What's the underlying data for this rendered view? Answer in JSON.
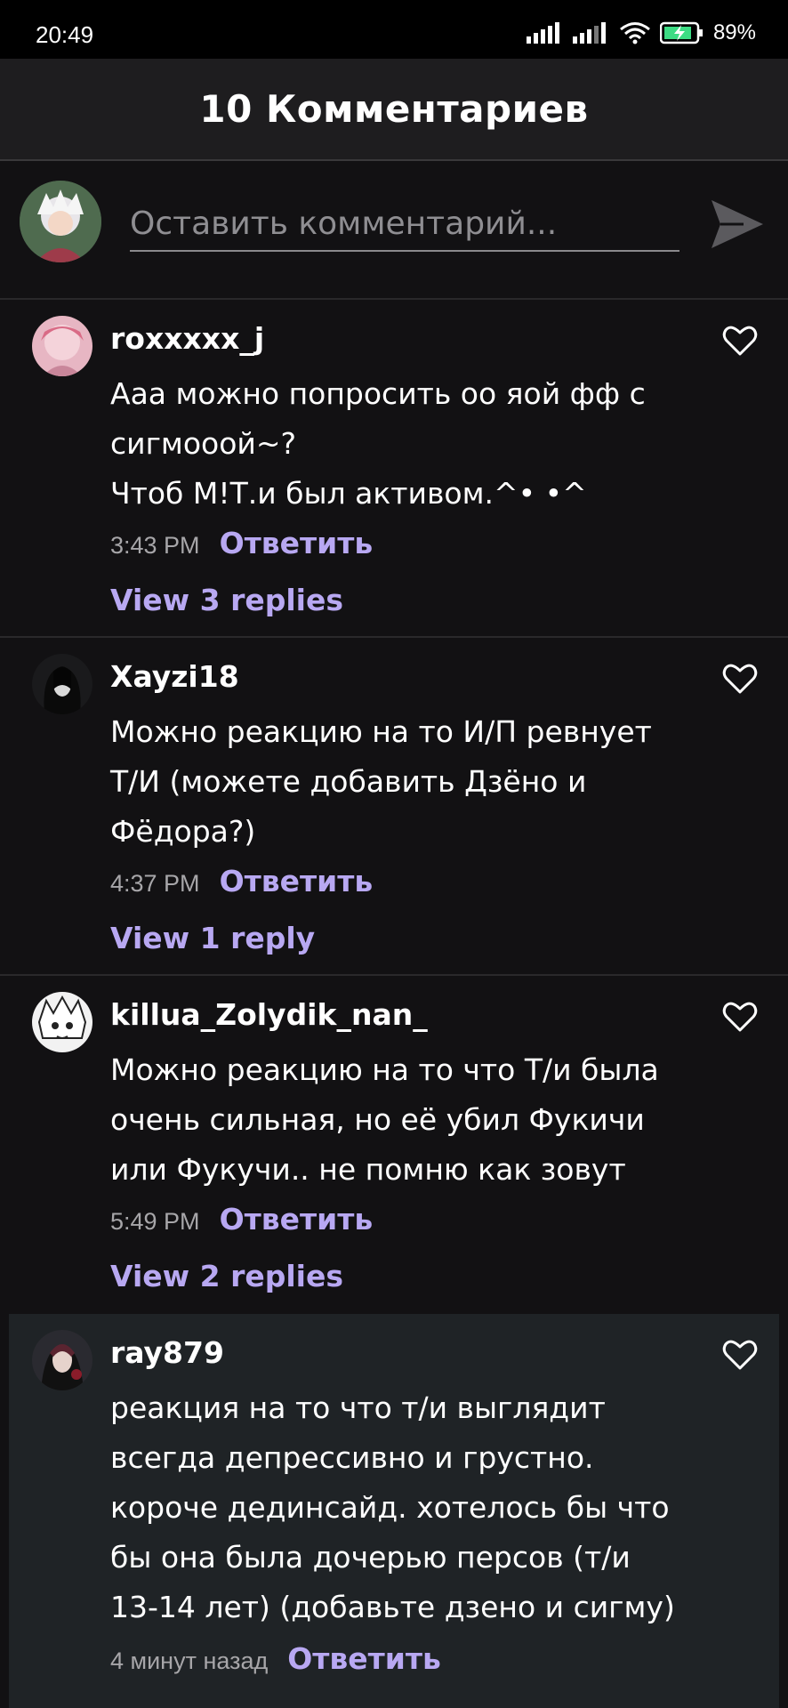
{
  "status_bar": {
    "time": "20:49",
    "battery_percent": "89%"
  },
  "header": {
    "title": "10 Комментариев"
  },
  "composer": {
    "placeholder": "Оставить комментарий..."
  },
  "comments": [
    {
      "username": "roxxxxx_j",
      "lines": [
        "Ааа можно попросить оо яой фф с",
        "сигмооой~?",
        "Чтоб М!Т.и был активом.^• •^"
      ],
      "time": "3:43 PM",
      "reply_label": "Ответить",
      "view_replies": "View 3 replies"
    },
    {
      "username": "Xayzi18",
      "lines": [
        "Можно реакцию на то И/П ревнует",
        "Т/И (можете добавить Дзёно и",
        "Фёдора?)"
      ],
      "time": "4:37 PM",
      "reply_label": "Ответить",
      "view_replies": "View 1 reply"
    },
    {
      "username": "killua_Zolydik_nan_",
      "lines": [
        "Можно реакцию на то что Т/и была",
        "очень сильная, но её убил Фукичи",
        "или Фукучи.. не помню как зовут"
      ],
      "time": "5:49 PM",
      "reply_label": "Ответить",
      "view_replies": "View 2 replies"
    },
    {
      "username": "ray879",
      "lines": [
        "реакция на то что т/и выглядит",
        "всегда депрессивно и грустно.",
        "короче дединсайд. хотелось бы что",
        "бы она была дочерью персов (т/и",
        "13-14 лет) (добавьте дзено и сигму)"
      ],
      "time": "4 минут назад",
      "reply_label": "Ответить"
    }
  ],
  "colors": {
    "accent": "#b8a8f2",
    "background": "#121113",
    "header": "#1e1d1f",
    "highlight": "#1f2326"
  },
  "icons": {
    "send": "send-arrow-icon",
    "like": "heart-outline-icon"
  }
}
